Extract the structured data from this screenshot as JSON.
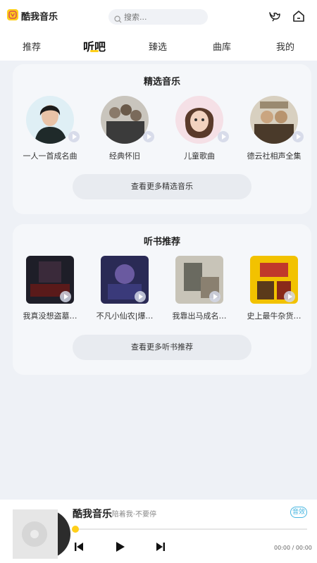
{
  "header": {
    "app_name": "酷我音乐",
    "search_placeholder": "搜索...",
    "icons": [
      "logo-icon",
      "search-icon",
      "bird-icon",
      "home-icon"
    ]
  },
  "tabs": [
    {
      "label": "推荐",
      "active": false
    },
    {
      "label": "听吧",
      "active": true
    },
    {
      "label": "臻选",
      "active": false
    },
    {
      "label": "曲库",
      "active": false
    },
    {
      "label": "我的",
      "active": false
    }
  ],
  "music_section": {
    "title": "精选音乐",
    "items": [
      {
        "label": "一人一首成名曲"
      },
      {
        "label": "经典怀旧"
      },
      {
        "label": "儿童歌曲"
      },
      {
        "label": "德云社相声全集"
      }
    ],
    "more_label": "查看更多精选音乐"
  },
  "book_section": {
    "title": "听书推荐",
    "items": [
      {
        "label": "我真没想盗墓…"
      },
      {
        "label": "不凡小仙农|爆…"
      },
      {
        "label": "我靠出马成名…"
      },
      {
        "label": "史上最牛杂货…"
      }
    ],
    "more_label": "查看更多听书推荐"
  },
  "player": {
    "title": "酷我音乐",
    "subtitle": "- 陪着我·不要停",
    "effect_label": "音效",
    "time": "00:00 / 00:00",
    "progress": 0
  },
  "colors": {
    "accent": "#ffcf1a",
    "effect": "#47b6e0",
    "background": "#eef1f6"
  }
}
